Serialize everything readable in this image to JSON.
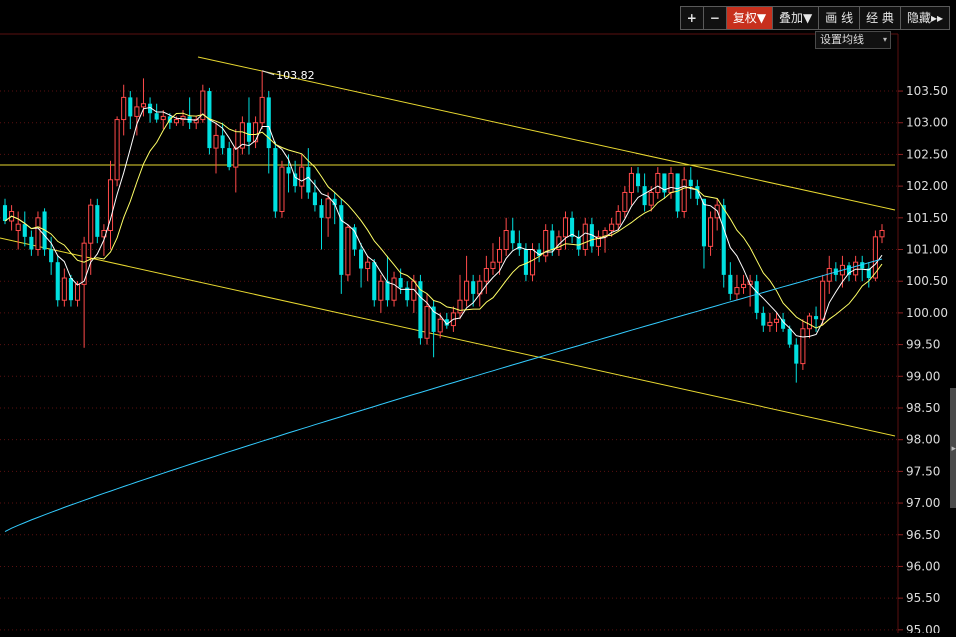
{
  "toolbar": {
    "plus_label": "+",
    "minus_label": "−",
    "fuquan_label": "复权▼",
    "diejia_label": "叠加▼",
    "huaxian_label": "画 线",
    "jingdian_label": "经 典",
    "yincang_label": "隐藏▸▸"
  },
  "ma_settings_label": "设置均线",
  "ma_dropdown_icon": "triangle-down-icon",
  "colors": {
    "background": "#000000",
    "grid": "#5a1010",
    "up": "#ff4a4a",
    "down": "#00e0e0",
    "ma_short": "#ffffff",
    "ma_medium": "#ffff66",
    "ma_long": "#33ccff",
    "trendline": "#e8d830",
    "axis_text": "#dddddd",
    "active_button": "#c7301d"
  },
  "chart_data": {
    "type": "candlestick",
    "y_axis_labels": [
      "103.50",
      "103.00",
      "102.50",
      "102.00",
      "101.50",
      "101.00",
      "100.50",
      "100.00",
      "99.50",
      "99.00",
      "98.50",
      "98.00",
      "97.50",
      "97.00",
      "96.50",
      "96.00",
      "95.50",
      "95.00"
    ],
    "ylim": [
      94.95,
      104.4
    ],
    "max_annotation": {
      "index": 39,
      "value": 103.82,
      "label": "103.82"
    },
    "candles": [
      [
        101.7,
        101.8,
        101.4,
        101.45
      ],
      [
        101.45,
        101.7,
        101.3,
        101.6
      ],
      [
        101.3,
        101.6,
        101.0,
        101.4
      ],
      [
        101.4,
        101.6,
        101.05,
        101.2
      ],
      [
        101.2,
        101.3,
        100.9,
        101.0
      ],
      [
        101.0,
        101.6,
        100.9,
        101.5
      ],
      [
        101.6,
        101.65,
        100.9,
        101.0
      ],
      [
        101.0,
        101.2,
        100.6,
        100.8
      ],
      [
        100.8,
        100.9,
        100.1,
        100.2
      ],
      [
        100.2,
        100.7,
        100.1,
        100.55
      ],
      [
        100.55,
        100.6,
        100.1,
        100.2
      ],
      [
        100.2,
        100.5,
        100.1,
        100.45
      ],
      [
        100.45,
        101.2,
        99.45,
        101.1
      ],
      [
        101.1,
        101.8,
        100.6,
        101.7
      ],
      [
        101.7,
        101.8,
        101.1,
        101.2
      ],
      [
        101.2,
        101.4,
        100.9,
        101.3
      ],
      [
        101.3,
        102.4,
        101.0,
        102.1
      ],
      [
        102.1,
        103.1,
        102.0,
        103.05
      ],
      [
        103.05,
        103.6,
        102.8,
        103.4
      ],
      [
        103.4,
        103.5,
        102.9,
        103.1
      ],
      [
        103.1,
        103.4,
        102.8,
        103.25
      ],
      [
        103.25,
        103.7,
        103.1,
        103.3
      ],
      [
        103.3,
        103.4,
        103.0,
        103.15
      ],
      [
        103.15,
        103.3,
        103.0,
        103.05
      ],
      [
        103.05,
        103.2,
        102.9,
        103.1
      ],
      [
        103.1,
        103.15,
        102.9,
        103.0
      ],
      [
        103.0,
        103.1,
        102.95,
        103.05
      ],
      [
        103.05,
        103.2,
        102.95,
        103.1
      ],
      [
        103.1,
        103.4,
        102.9,
        103.0
      ],
      [
        103.0,
        103.1,
        102.9,
        103.05
      ],
      [
        103.05,
        103.6,
        103.0,
        103.5
      ],
      [
        103.5,
        103.55,
        102.5,
        102.6
      ],
      [
        102.6,
        103.0,
        102.2,
        102.8
      ],
      [
        102.8,
        103.0,
        102.5,
        102.6
      ],
      [
        102.6,
        102.7,
        102.25,
        102.3
      ],
      [
        102.3,
        102.9,
        101.9,
        102.6
      ],
      [
        102.6,
        103.1,
        102.5,
        103.0
      ],
      [
        103.0,
        103.4,
        102.5,
        102.7
      ],
      [
        102.7,
        103.1,
        102.6,
        103.0
      ],
      [
        103.0,
        103.82,
        102.9,
        103.4
      ],
      [
        103.4,
        103.5,
        102.2,
        102.6
      ],
      [
        102.6,
        102.7,
        101.5,
        101.6
      ],
      [
        101.6,
        102.4,
        101.5,
        102.3
      ],
      [
        102.3,
        102.5,
        101.9,
        102.2
      ],
      [
        102.2,
        102.4,
        101.9,
        102.0
      ],
      [
        102.0,
        102.5,
        101.8,
        102.3
      ],
      [
        102.3,
        102.6,
        101.8,
        101.9
      ],
      [
        101.9,
        102.1,
        101.6,
        101.7
      ],
      [
        101.7,
        101.8,
        101.0,
        101.5
      ],
      [
        101.5,
        101.9,
        101.2,
        101.8
      ],
      [
        101.8,
        101.9,
        101.4,
        101.7
      ],
      [
        101.7,
        101.8,
        100.3,
        100.6
      ],
      [
        100.6,
        101.4,
        100.5,
        101.35
      ],
      [
        101.35,
        101.4,
        100.9,
        101.0
      ],
      [
        101.0,
        101.1,
        100.4,
        100.7
      ],
      [
        100.7,
        100.9,
        100.5,
        100.8
      ],
      [
        100.8,
        100.85,
        100.1,
        100.2
      ],
      [
        100.2,
        100.6,
        100.0,
        100.5
      ],
      [
        100.5,
        100.9,
        100.1,
        100.2
      ],
      [
        100.2,
        100.65,
        100.1,
        100.55
      ],
      [
        100.55,
        100.7,
        100.3,
        100.4
      ],
      [
        100.4,
        100.5,
        100.1,
        100.2
      ],
      [
        100.2,
        100.6,
        100.0,
        100.5
      ],
      [
        100.5,
        100.6,
        99.5,
        99.6
      ],
      [
        99.6,
        100.3,
        99.5,
        100.1
      ],
      [
        100.1,
        100.2,
        99.3,
        99.7
      ],
      [
        99.7,
        100.0,
        99.6,
        99.9
      ],
      [
        99.9,
        100.0,
        99.75,
        99.8
      ],
      [
        99.8,
        100.1,
        99.7,
        100.0
      ],
      [
        100.0,
        100.6,
        99.9,
        100.2
      ],
      [
        100.2,
        100.9,
        100.1,
        100.5
      ],
      [
        100.5,
        100.6,
        100.1,
        100.3
      ],
      [
        100.3,
        100.6,
        100.1,
        100.5
      ],
      [
        100.5,
        100.9,
        100.3,
        100.7
      ],
      [
        100.7,
        101.1,
        100.6,
        100.8
      ],
      [
        100.8,
        101.2,
        100.6,
        101.0
      ],
      [
        101.0,
        101.5,
        100.9,
        101.3
      ],
      [
        101.3,
        101.5,
        101.0,
        101.1
      ],
      [
        101.1,
        101.3,
        100.9,
        101.0
      ],
      [
        101.0,
        101.1,
        100.5,
        100.6
      ],
      [
        100.6,
        101.1,
        100.5,
        101.0
      ],
      [
        101.0,
        101.1,
        100.8,
        100.9
      ],
      [
        100.9,
        101.4,
        100.8,
        101.3
      ],
      [
        101.3,
        101.4,
        100.9,
        101.0
      ],
      [
        101.0,
        101.3,
        100.9,
        101.2
      ],
      [
        101.2,
        101.6,
        101.0,
        101.5
      ],
      [
        101.5,
        101.6,
        101.1,
        101.2
      ],
      [
        101.2,
        101.3,
        100.9,
        101.0
      ],
      [
        101.0,
        101.5,
        100.9,
        101.4
      ],
      [
        101.4,
        101.5,
        100.95,
        101.05
      ],
      [
        101.05,
        101.3,
        100.9,
        101.2
      ],
      [
        101.2,
        101.35,
        100.95,
        101.3
      ],
      [
        101.3,
        101.5,
        101.2,
        101.4
      ],
      [
        101.4,
        101.7,
        101.3,
        101.6
      ],
      [
        101.6,
        102.0,
        101.5,
        101.9
      ],
      [
        101.9,
        102.3,
        101.7,
        102.2
      ],
      [
        102.2,
        102.3,
        101.9,
        102.0
      ],
      [
        102.0,
        102.2,
        101.6,
        101.7
      ],
      [
        101.7,
        102.0,
        101.6,
        101.9
      ],
      [
        101.9,
        102.3,
        101.8,
        102.2
      ],
      [
        102.2,
        102.2,
        101.8,
        101.9
      ],
      [
        101.9,
        102.3,
        101.8,
        102.2
      ],
      [
        102.2,
        102.2,
        101.5,
        101.6
      ],
      [
        101.6,
        102.3,
        101.5,
        102.1
      ],
      [
        102.1,
        102.3,
        101.8,
        102.0
      ],
      [
        102.0,
        102.1,
        101.7,
        101.8
      ],
      [
        101.8,
        101.8,
        100.7,
        101.05
      ],
      [
        101.05,
        101.6,
        100.9,
        101.5
      ],
      [
        101.5,
        101.8,
        101.3,
        101.7
      ],
      [
        101.7,
        101.8,
        100.4,
        100.6
      ],
      [
        100.6,
        100.8,
        100.2,
        100.3
      ],
      [
        100.3,
        100.6,
        100.2,
        100.4
      ],
      [
        100.4,
        100.6,
        100.3,
        100.45
      ],
      [
        100.45,
        100.6,
        100.1,
        100.5
      ],
      [
        100.5,
        100.6,
        99.9,
        100.0
      ],
      [
        100.0,
        100.1,
        99.7,
        99.8
      ],
      [
        99.8,
        100.0,
        99.7,
        99.85
      ],
      [
        99.85,
        100.0,
        99.7,
        99.9
      ],
      [
        99.9,
        100.0,
        99.7,
        99.75
      ],
      [
        99.75,
        99.8,
        99.45,
        99.5
      ],
      [
        99.5,
        99.6,
        98.9,
        99.2
      ],
      [
        99.2,
        99.9,
        99.1,
        99.75
      ],
      [
        99.75,
        100.0,
        99.6,
        99.95
      ],
      [
        99.95,
        100.1,
        99.7,
        99.9
      ],
      [
        99.9,
        100.6,
        99.8,
        100.5
      ],
      [
        100.5,
        100.9,
        100.3,
        100.7
      ],
      [
        100.7,
        100.8,
        100.5,
        100.6
      ],
      [
        100.6,
        100.9,
        100.4,
        100.75
      ],
      [
        100.75,
        100.8,
        100.5,
        100.6
      ],
      [
        100.6,
        100.9,
        100.5,
        100.8
      ],
      [
        100.8,
        100.9,
        100.5,
        100.7
      ],
      [
        100.7,
        100.8,
        100.4,
        100.55
      ],
      [
        100.55,
        101.3,
        100.5,
        101.2
      ],
      [
        101.2,
        101.4,
        101.1,
        101.3
      ]
    ],
    "trendlines": [
      {
        "name": "upper-channel",
        "points": [
          [
            198,
            57
          ],
          [
            895,
            210
          ]
        ]
      },
      {
        "name": "lower-channel",
        "points": [
          [
            0,
            238
          ],
          [
            895,
            436
          ]
        ]
      },
      {
        "name": "resistance",
        "points": [
          [
            0,
            165
          ],
          [
            895,
            165
          ]
        ]
      }
    ],
    "moving_averages": [
      {
        "name": "MA5",
        "color": "#ffffff",
        "period": 5
      },
      {
        "name": "MA10",
        "color": "#ffff66",
        "period": 10
      },
      {
        "name": "MA-long",
        "color": "#33ccff",
        "start": 96.55,
        "end": 100.85
      }
    ],
    "grid": "dotted-horizontal"
  }
}
